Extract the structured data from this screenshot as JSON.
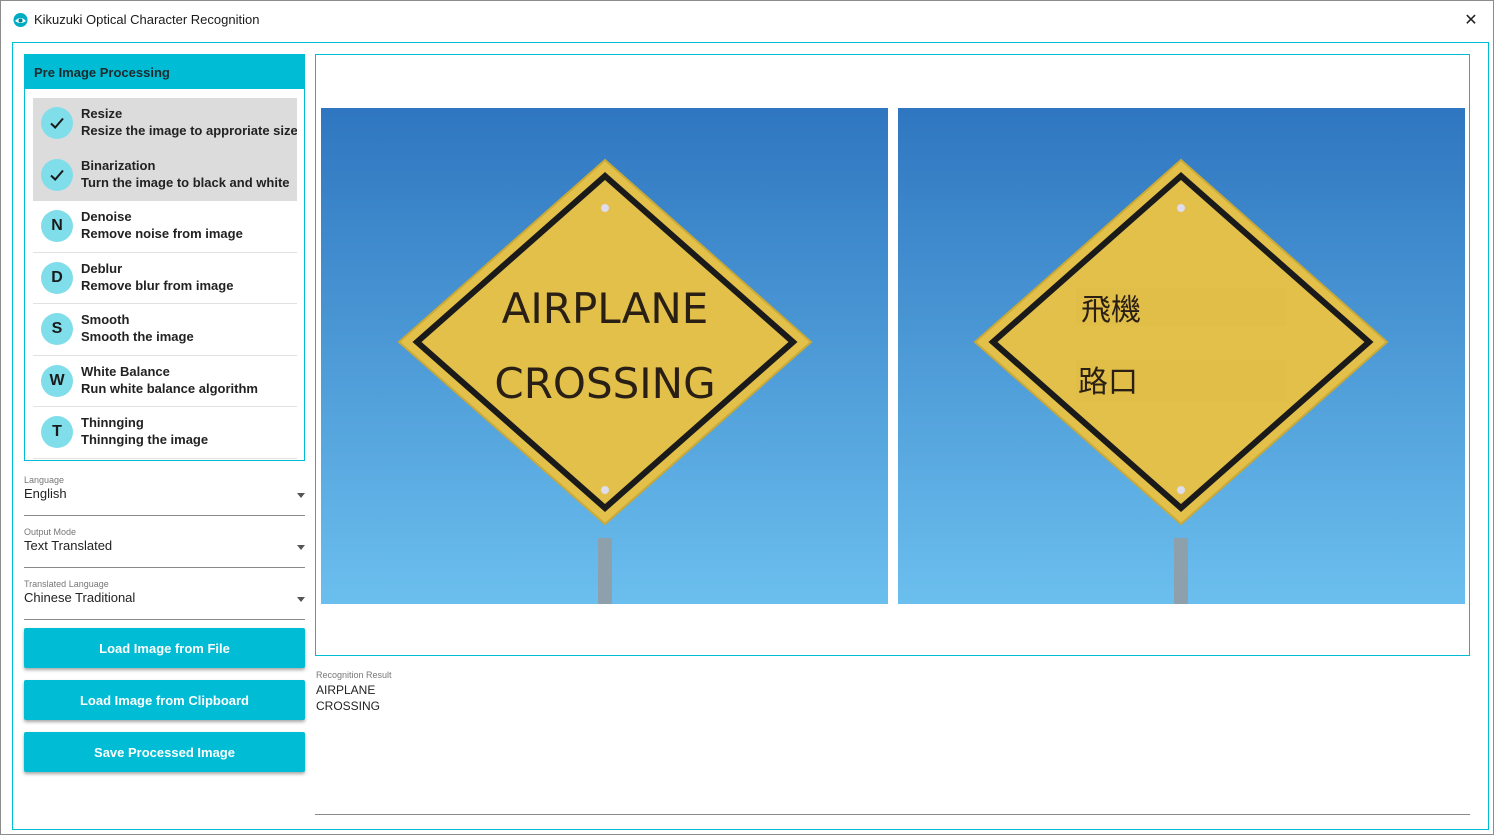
{
  "window": {
    "title": "Kikuzuki Optical Character Recognition",
    "close_glyph": "✕"
  },
  "panel": {
    "header": "Pre Image Processing",
    "items": [
      {
        "badge": "",
        "badge_icon": "check-icon",
        "title": "Resize",
        "desc": "Resize the image to approriate size",
        "selected": true
      },
      {
        "badge": "",
        "badge_icon": "check-icon",
        "title": "Binarization",
        "desc": "Turn the image to black and white",
        "selected": true
      },
      {
        "badge": "N",
        "title": "Denoise",
        "desc": "Remove noise from image",
        "selected": false
      },
      {
        "badge": "D",
        "title": "Deblur",
        "desc": "Remove blur from image",
        "selected": false
      },
      {
        "badge": "S",
        "title": "Smooth",
        "desc": "Smooth the image",
        "selected": false
      },
      {
        "badge": "W",
        "title": "White Balance",
        "desc": "Run white balance algorithm",
        "selected": false
      },
      {
        "badge": "T",
        "title": "Thinnging",
        "desc": "Thinnging the image",
        "selected": false
      }
    ]
  },
  "combos": {
    "language": {
      "label": "Language",
      "value": "English"
    },
    "output_mode": {
      "label": "Output Mode",
      "value": "Text Translated"
    },
    "translated_language": {
      "label": "Translated Language",
      "value": "Chinese Traditional"
    }
  },
  "buttons": {
    "load_file": "Load Image from File",
    "load_clipboard": "Load Image from Clipboard",
    "save_processed": "Save Processed Image"
  },
  "images": {
    "original": {
      "line1": "AIRPLANE",
      "line2": "CROSSING"
    },
    "translated": {
      "line1": "飛機",
      "line2": "路口"
    }
  },
  "result": {
    "label": "Recognition Result",
    "text": "AIRPLANE\nCROSSING"
  },
  "colors": {
    "accent": "#00bcd4",
    "badge": "#80deea",
    "sign_yellow": "#e2c04a",
    "sky_top": "#2f76c0",
    "sky_bottom": "#6bbfee"
  }
}
